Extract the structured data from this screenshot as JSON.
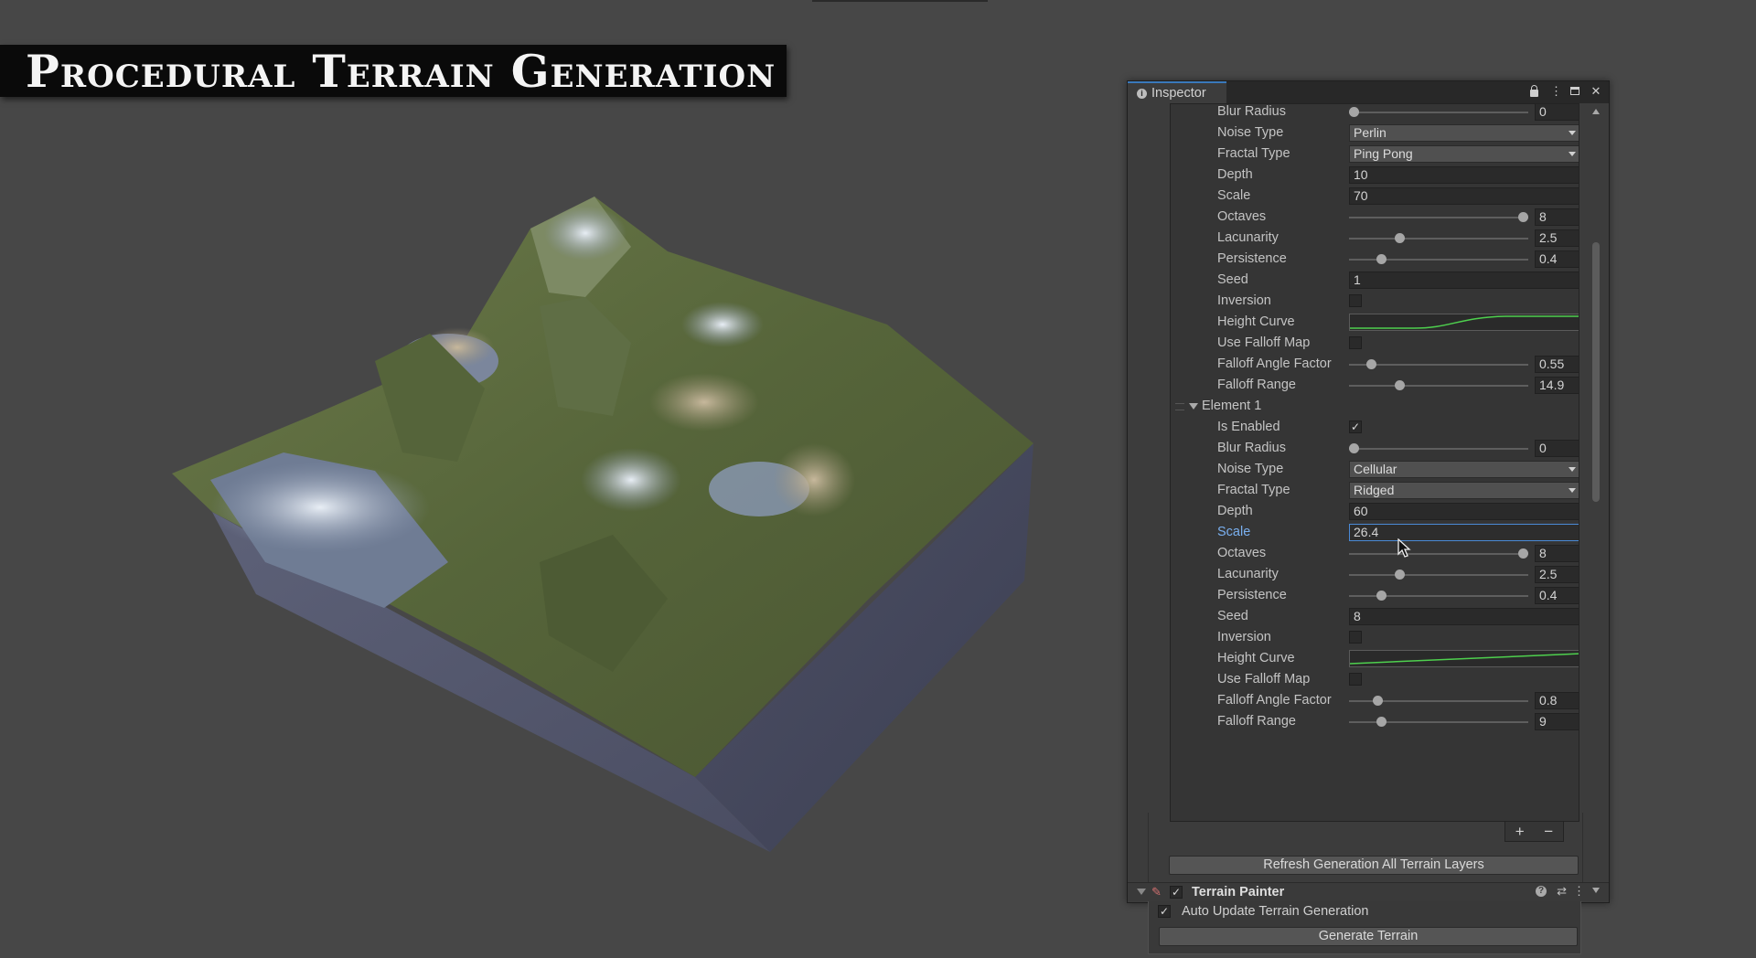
{
  "title": "Procedural Terrain Generation",
  "inspector": {
    "tab": "Inspector",
    "element0": {
      "blur_radius": {
        "label": "Blur Radius",
        "value": "0",
        "level": 0.0
      },
      "noise_type": {
        "label": "Noise Type",
        "value": "Perlin"
      },
      "fractal_type": {
        "label": "Fractal Type",
        "value": "Ping Pong"
      },
      "depth": {
        "label": "Depth",
        "value": "10"
      },
      "scale": {
        "label": "Scale",
        "value": "70"
      },
      "octaves": {
        "label": "Octaves",
        "value": "8",
        "level": 1.0
      },
      "lacunarity": {
        "label": "Lacunarity",
        "value": "2.5",
        "level": 0.27
      },
      "persistence": {
        "label": "Persistence",
        "value": "0.4",
        "level": 0.16
      },
      "seed": {
        "label": "Seed",
        "value": "1"
      },
      "inversion": {
        "label": "Inversion",
        "checked": false
      },
      "height_curve": {
        "label": "Height Curve"
      },
      "use_falloff_map": {
        "label": "Use Falloff Map",
        "checked": false
      },
      "falloff_angle_factor": {
        "label": "Falloff Angle Factor",
        "value": "0.55",
        "level": 0.1
      },
      "falloff_range": {
        "label": "Falloff Range",
        "value": "14.9",
        "level": 0.27
      }
    },
    "element1": {
      "header": "Element 1",
      "is_enabled": {
        "label": "Is Enabled",
        "checked": true
      },
      "blur_radius": {
        "label": "Blur Radius",
        "value": "0",
        "level": 0.0
      },
      "noise_type": {
        "label": "Noise Type",
        "value": "Cellular"
      },
      "fractal_type": {
        "label": "Fractal Type",
        "value": "Ridged"
      },
      "depth": {
        "label": "Depth",
        "value": "60"
      },
      "scale": {
        "label": "Scale",
        "value": "26.4"
      },
      "octaves": {
        "label": "Octaves",
        "value": "8",
        "level": 1.0
      },
      "lacunarity": {
        "label": "Lacunarity",
        "value": "2.5",
        "level": 0.27
      },
      "persistence": {
        "label": "Persistence",
        "value": "0.4",
        "level": 0.16
      },
      "seed": {
        "label": "Seed",
        "value": "8"
      },
      "inversion": {
        "label": "Inversion",
        "checked": false
      },
      "height_curve": {
        "label": "Height Curve"
      },
      "use_falloff_map": {
        "label": "Use Falloff Map",
        "checked": false
      },
      "falloff_angle_factor": {
        "label": "Falloff Angle Factor",
        "value": "0.8",
        "level": 0.14
      },
      "falloff_range": {
        "label": "Falloff Range",
        "value": "9",
        "level": 0.16
      }
    },
    "add_label": "+",
    "remove_label": "−",
    "refresh_button": "Refresh Generation All Terrain Layers",
    "auto_update": {
      "label": "Auto Update Terrain Generation",
      "checked": true
    },
    "generate_button": "Generate Terrain",
    "component": {
      "name": "Terrain Painter",
      "enabled": true
    }
  },
  "colors": {
    "accent": "#3a79bb",
    "curve": "#4ed04e",
    "focus_label": "#7ab0f0"
  }
}
